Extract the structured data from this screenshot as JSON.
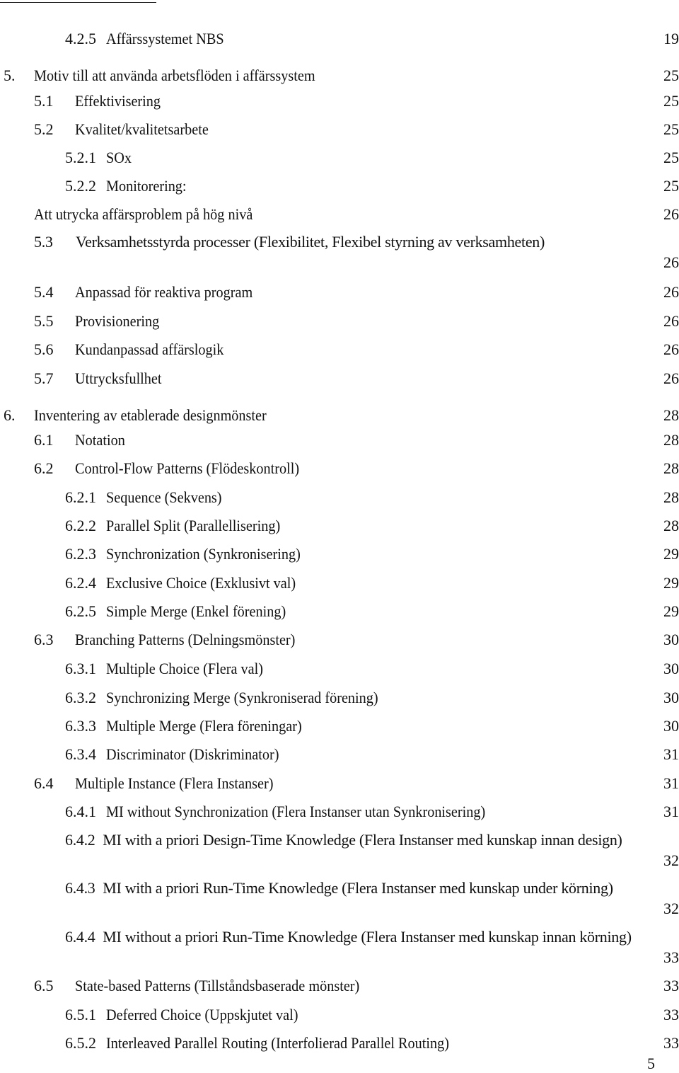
{
  "toc": [
    {
      "level": 3,
      "num": "4.2.5",
      "title": "Affärssystemet NBS",
      "page": "19"
    },
    {
      "level": 1,
      "num": "5.",
      "title": "Motiv till att använda arbetsflöden i affärssystem",
      "page": "25"
    },
    {
      "level": 2,
      "num": "5.1",
      "title": "Effektivisering",
      "page": "25"
    },
    {
      "level": 2,
      "num": "5.2",
      "title": "Kvalitet/kvalitetsarbete",
      "page": "25"
    },
    {
      "level": 3,
      "num": "5.2.1",
      "title": "SOx",
      "page": "25"
    },
    {
      "level": 3,
      "num": "5.2.2",
      "title": "Monitorering:",
      "page": "25"
    },
    {
      "level": 0,
      "num": "",
      "title": "Att utrycka affärsproblem på hög nivå",
      "page": "26"
    },
    {
      "level": 2,
      "num": "5.3",
      "title": "Verksamhetsstyrda processer (Flexibilitet, Flexibel styrning av verksamheten)",
      "page": "26"
    },
    {
      "level": 2,
      "num": "5.4",
      "title": "Anpassad för reaktiva program",
      "page": "26"
    },
    {
      "level": 2,
      "num": "5.5",
      "title": "Provisionering",
      "page": "26"
    },
    {
      "level": 2,
      "num": "5.6",
      "title": "Kundanpassad affärslogik",
      "page": "26"
    },
    {
      "level": 2,
      "num": "5.7",
      "title": "Uttrycksfullhet",
      "page": "26"
    },
    {
      "level": 1,
      "num": "6.",
      "title": "Inventering av etablerade designmönster",
      "page": "28"
    },
    {
      "level": 2,
      "num": "6.1",
      "title": "Notation",
      "page": "28"
    },
    {
      "level": 2,
      "num": "6.2",
      "title": "Control-Flow Patterns (Flödeskontroll)",
      "page": "28"
    },
    {
      "level": 3,
      "num": "6.2.1",
      "title": "Sequence (Sekvens)",
      "page": "28"
    },
    {
      "level": 3,
      "num": "6.2.2",
      "title": "Parallel Split (Parallellisering)",
      "page": "28"
    },
    {
      "level": 3,
      "num": "6.2.3",
      "title": "Synchronization (Synkronisering)",
      "page": "29"
    },
    {
      "level": 3,
      "num": "6.2.4",
      "title": "Exclusive Choice (Exklusivt val)",
      "page": "29"
    },
    {
      "level": 3,
      "num": "6.2.5",
      "title": "Simple Merge (Enkel förening)",
      "page": "29"
    },
    {
      "level": 2,
      "num": "6.3",
      "title": "Branching Patterns (Delningsmönster)",
      "page": "30"
    },
    {
      "level": 3,
      "num": "6.3.1",
      "title": "Multiple Choice (Flera val)",
      "page": "30"
    },
    {
      "level": 3,
      "num": "6.3.2",
      "title": "Synchronizing Merge (Synkroniserad förening)",
      "page": "30"
    },
    {
      "level": 3,
      "num": "6.3.3",
      "title": "Multiple Merge (Flera föreningar)",
      "page": "30"
    },
    {
      "level": 3,
      "num": "6.3.4",
      "title": "Discriminator (Diskriminator)",
      "page": "31"
    },
    {
      "level": 2,
      "num": "6.4",
      "title": "Multiple Instance (Flera Instanser)",
      "page": "31"
    },
    {
      "level": 3,
      "num": "6.4.1",
      "title": "MI without Synchronization (Flera Instanser utan Synkronisering)",
      "page": "31"
    },
    {
      "level": 3,
      "num": "6.4.2",
      "title": "MI with a priori Design-Time Knowledge (Flera Instanser med kunskap innan design)",
      "page": "32"
    },
    {
      "level": 3,
      "num": "6.4.3",
      "title": "MI with a priori Run-Time Knowledge (Flera Instanser med kunskap under körning)",
      "page": "32"
    },
    {
      "level": 3,
      "num": "6.4.4",
      "title": "MI without a priori Run-Time Knowledge (Flera Instanser med kunskap innan körning)",
      "page": "33"
    },
    {
      "level": 2,
      "num": "6.5",
      "title": "State-based Patterns (Tillståndsbaserade mönster)",
      "page": "33"
    },
    {
      "level": 3,
      "num": "6.5.1",
      "title": "Deferred Choice (Uppskjutet val)",
      "page": "33"
    },
    {
      "level": 3,
      "num": "6.5.2",
      "title": "Interleaved Parallel Routing (Interfolierad Parallel Routing)",
      "page": "33"
    }
  ],
  "footer": {
    "page_number": "5"
  }
}
